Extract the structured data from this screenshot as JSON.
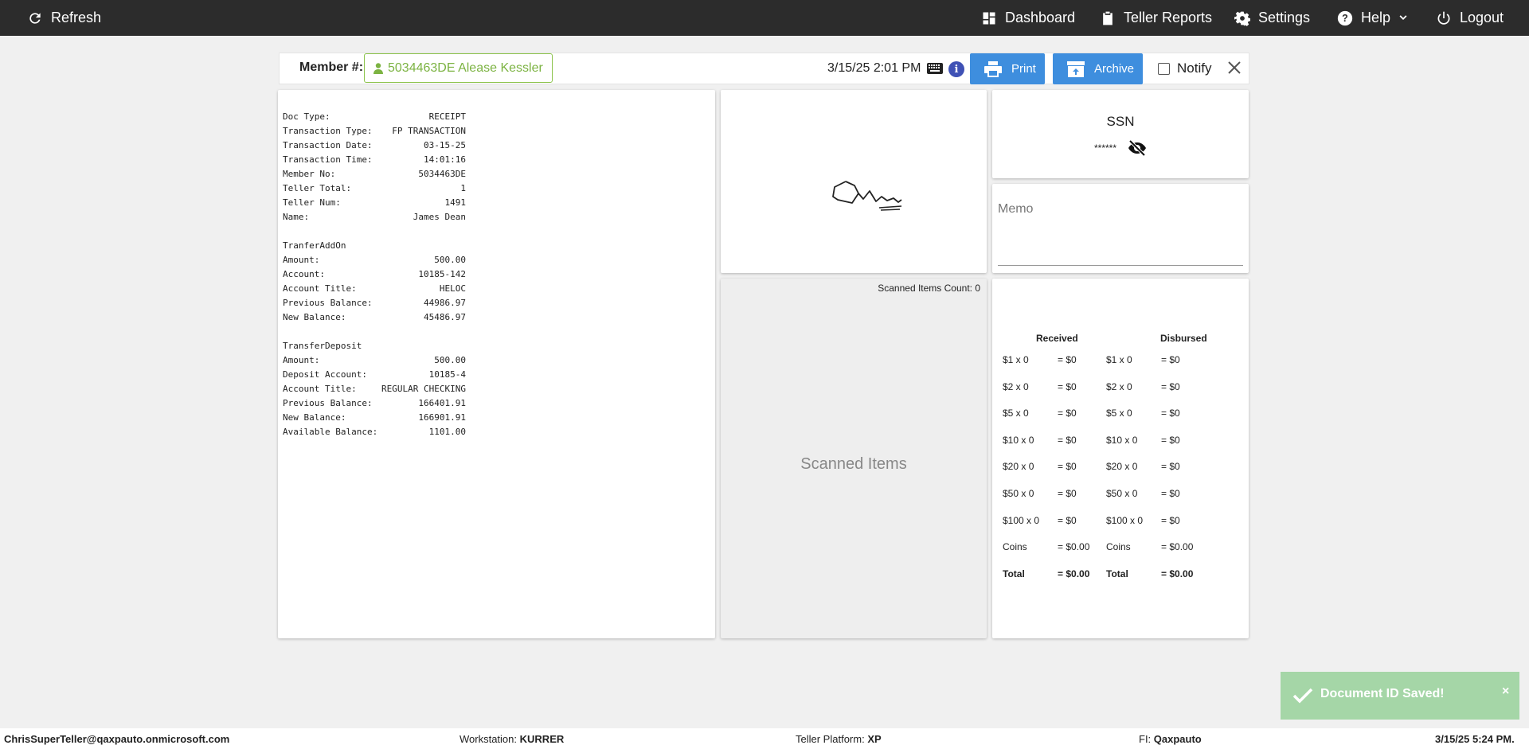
{
  "topbar": {
    "refresh": "Refresh",
    "dashboard": "Dashboard",
    "teller_reports": "Teller Reports",
    "settings": "Settings",
    "help": "Help",
    "logout": "Logout"
  },
  "header": {
    "member_label": "Member #:",
    "member_value": "5034463DE Alease Kessler",
    "datetime": "3/15/25 2:01 PM",
    "print": "Print",
    "archive": "Archive",
    "notify": "Notify"
  },
  "receipt": [
    {
      "k": "Doc Type:",
      "v": "RECEIPT"
    },
    {
      "k": "Transaction Type:",
      "v": "FP TRANSACTION"
    },
    {
      "k": "Transaction Date:",
      "v": "03-15-25"
    },
    {
      "k": "Transaction Time:",
      "v": "14:01:16"
    },
    {
      "k": "Member No:",
      "v": "5034463DE"
    },
    {
      "k": "Teller Total:",
      "v": "1"
    },
    {
      "k": "Teller Num:",
      "v": "1491"
    },
    {
      "k": "Name:",
      "v": "James Dean"
    },
    {
      "k": "",
      "v": ""
    },
    {
      "k": "TranferAddOn",
      "v": ""
    },
    {
      "k": "Amount:",
      "v": "500.00"
    },
    {
      "k": "Account:",
      "v": "10185-142"
    },
    {
      "k": "Account Title:",
      "v": "HELOC"
    },
    {
      "k": "Previous Balance:",
      "v": "44986.97"
    },
    {
      "k": "New Balance:",
      "v": "45486.97"
    },
    {
      "k": "",
      "v": ""
    },
    {
      "k": "TransferDeposit",
      "v": ""
    },
    {
      "k": "Amount:",
      "v": "500.00"
    },
    {
      "k": "Deposit Account:",
      "v": "10185-4"
    },
    {
      "k": "Account Title:",
      "v": "REGULAR CHECKING"
    },
    {
      "k": "Previous Balance:",
      "v": "166401.91"
    },
    {
      "k": "New Balance:",
      "v": "166901.91"
    },
    {
      "k": "Available Balance:",
      "v": "1101.00"
    }
  ],
  "scanned": {
    "count_label": "Scanned Items Count: 0",
    "title": "Scanned Items"
  },
  "ssn": {
    "label": "SSN",
    "value": "******"
  },
  "memo": {
    "label": "Memo"
  },
  "cash": {
    "received_label": "Received",
    "disbursed_label": "Disbursed",
    "rows": [
      {
        "denom": "$1",
        "count": "0",
        "amount": "= $0",
        "bold": false
      },
      {
        "denom": "$2",
        "count": "0",
        "amount": "= $0",
        "bold": false
      },
      {
        "denom": "$5",
        "count": "0",
        "amount": "= $0",
        "bold": false
      },
      {
        "denom": "$10",
        "count": "0",
        "amount": "= $0",
        "bold": false
      },
      {
        "denom": "$20",
        "count": "0",
        "amount": "= $0",
        "bold": false
      },
      {
        "denom": "$50",
        "count": "0",
        "amount": "= $0",
        "bold": false
      },
      {
        "denom": "$100",
        "count": "0",
        "amount": "= $0",
        "bold": false
      },
      {
        "denom": "Coins",
        "count": "",
        "amount": "= $0.00",
        "bold": false
      },
      {
        "denom": "Total",
        "count": "",
        "amount": "= $0.00",
        "bold": true
      }
    ]
  },
  "toast": {
    "message": "Document ID Saved!",
    "close": "×"
  },
  "footer": {
    "user": "ChrisSuperTeller@qaxpauto.onmicrosoft.com",
    "workstation_label": "Workstation:",
    "workstation": "KURRER",
    "platform_label": "Teller Platform:",
    "platform": "XP",
    "fi_label": "FI:",
    "fi": "Qaxpauto",
    "datetime": "3/15/25 5:24 PM."
  },
  "colors": {
    "topbar": "#2c2c2c",
    "button": "#3e8ede",
    "member_green": "#7cb342",
    "toast": "#a5d6a7"
  }
}
